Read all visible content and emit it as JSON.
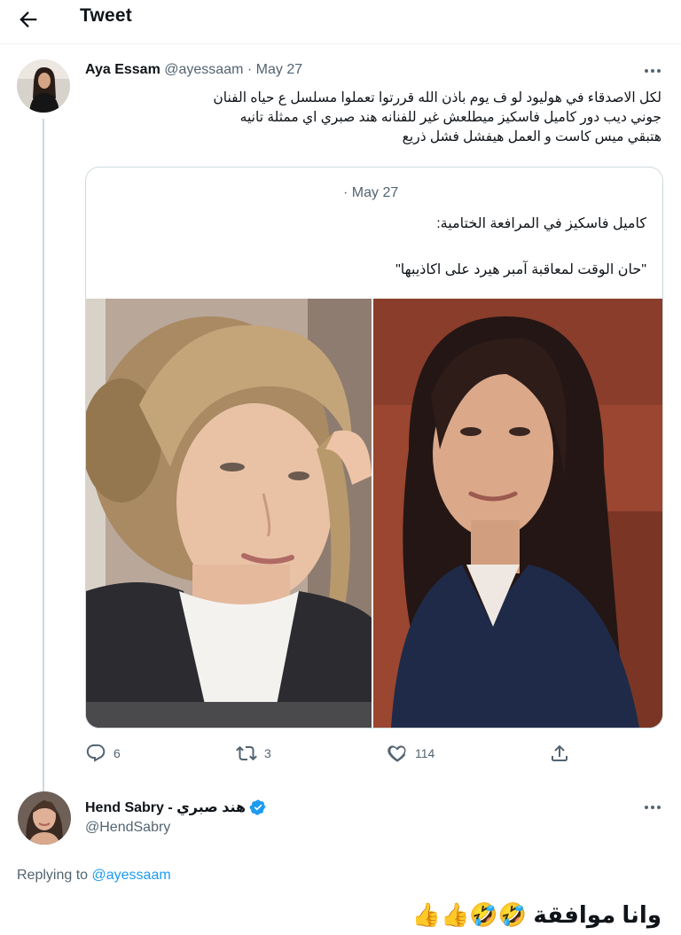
{
  "header": {
    "title": "Tweet"
  },
  "tweet1": {
    "author_name": "Aya Essam",
    "author_handle": "@ayessaam",
    "separator": "·",
    "date": "May 27",
    "text_lines": [
      "لكل الاصدقاء في هوليود لو ف يوم باذن الله قررتوا تعملوا مسلسل ع حياه الفنان",
      "جوني ديب دور كاميل فاسكيز ميطلعش غير للفنانه هند صبري اي ممثلة تانيه",
      "هتبقي ميس كاست و العمل هيفشل فشل ذريع"
    ],
    "quote": {
      "meta": "· May 27",
      "line1": "كاميل فاسكيز في المرافعة الختامية:",
      "line2": "\"حان الوقت لمعاقبة آمبر هيرد على اكاذيبها\""
    },
    "actions": {
      "replies": "6",
      "retweets": "3",
      "likes": "114"
    }
  },
  "tweet2": {
    "author_name": "Hend Sabry - هند صبري",
    "author_handle": "@HendSabry",
    "replying_prefix": "Replying to",
    "replying_handle": "@ayessaam",
    "text": "وانا موافقة 🤣🤣👍👍"
  },
  "colors": {
    "accent": "#1d9bf0",
    "muted": "#536471",
    "border": "#cfd9de"
  },
  "icons": [
    "back-arrow-icon",
    "more-icon",
    "reply-icon",
    "retweet-icon",
    "like-icon",
    "share-icon",
    "verified-badge-icon"
  ]
}
